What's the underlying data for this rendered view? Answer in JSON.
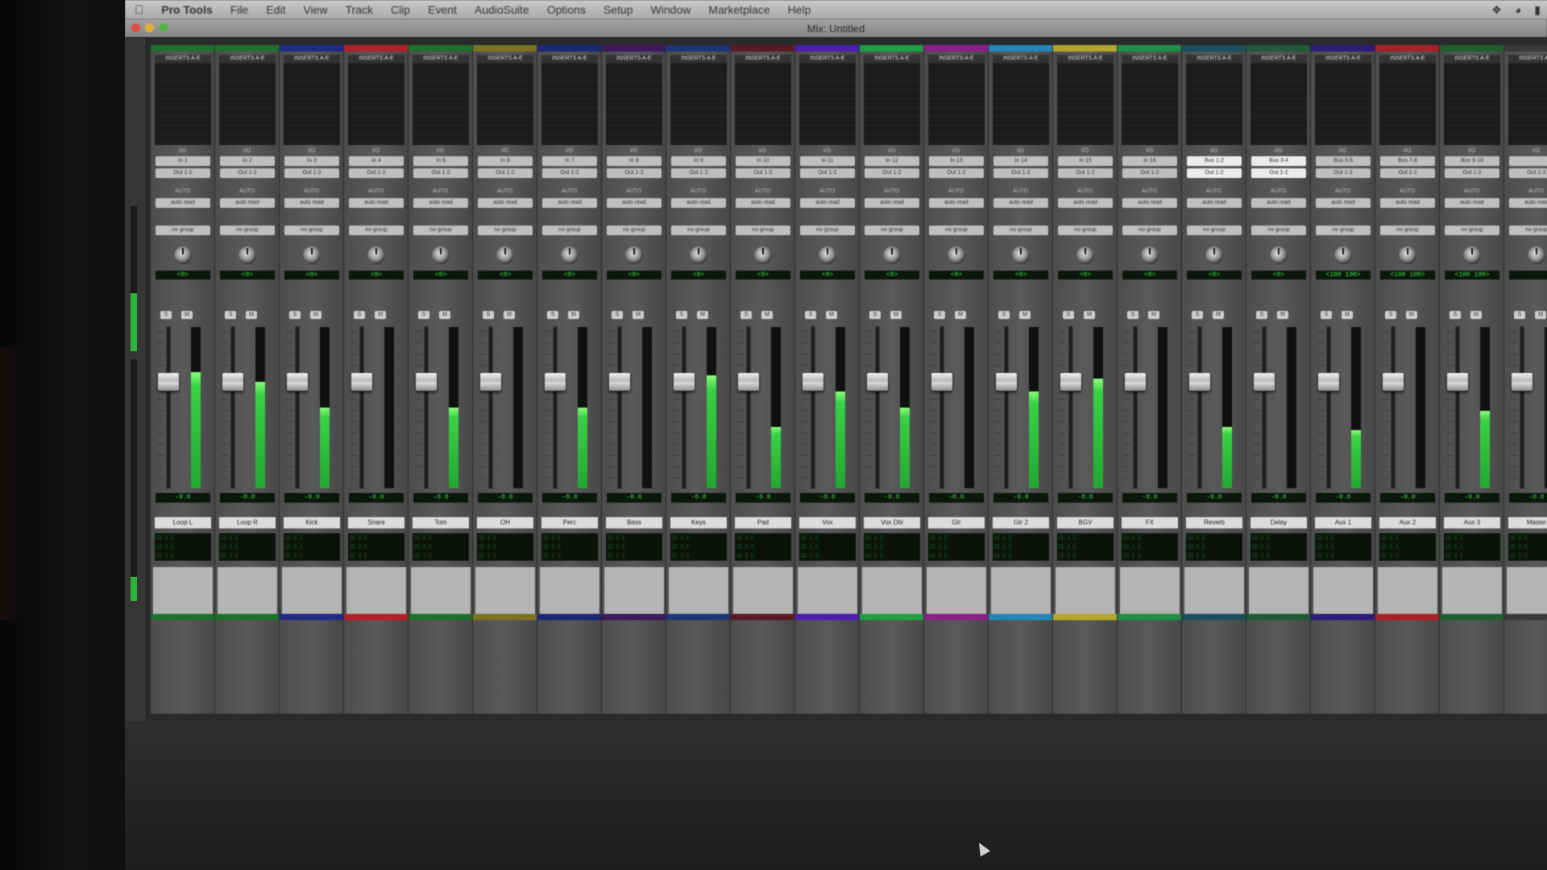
{
  "menubar": {
    "apple_icon": "apple-icon",
    "app_name": "Pro Tools",
    "items": [
      "File",
      "Edit",
      "View",
      "Track",
      "Clip",
      "Event",
      "AudioSuite",
      "Options",
      "Setup",
      "Window",
      "Marketplace",
      "Help"
    ],
    "status_icons": [
      "bluetooth-icon",
      "wifi-icon",
      "battery-icon"
    ]
  },
  "window": {
    "title": "Mix: Untitled"
  },
  "labels": {
    "inserts_header": "INSERTS A-E",
    "io": "I/O",
    "auto": "AUTO",
    "auto_value": "auto read",
    "group_value": "no group",
    "solo": "S",
    "mute": "M"
  },
  "strips": [
    {
      "name": "Loop L",
      "color": "#1f6f2e",
      "input": "In 1",
      "output": "Out 1-2",
      "pan": "<0>",
      "volume": "-0.0",
      "meter": 0.72,
      "fader": 0.68
    },
    {
      "name": "Loop R",
      "color": "#1f6f2e",
      "input": "In 2",
      "output": "Out 1-2",
      "pan": "<0>",
      "volume": "-0.0",
      "meter": 0.66,
      "fader": 0.68
    },
    {
      "name": "Kick",
      "color": "#232a86",
      "input": "In 3",
      "output": "Out 1-2",
      "pan": "<0>",
      "volume": "-0.0",
      "meter": 0.5,
      "fader": 0.68
    },
    {
      "name": "Snare",
      "color": "#b3202a",
      "input": "In 4",
      "output": "Out 1-2",
      "pan": "<0>",
      "volume": "-0.0",
      "meter": 0.0,
      "fader": 0.68
    },
    {
      "name": "Tom",
      "color": "#1f6f2e",
      "input": "In 5",
      "output": "Out 1-2",
      "pan": "<0>",
      "volume": "-0.0",
      "meter": 0.5,
      "fader": 0.68
    },
    {
      "name": "OH",
      "color": "#7a7322",
      "input": "In 6",
      "output": "Out 1-2",
      "pan": "<0>",
      "volume": "-0.0",
      "meter": 0.0,
      "fader": 0.68
    },
    {
      "name": "Perc",
      "color": "#1d2773",
      "input": "In 7",
      "output": "Out 1-2",
      "pan": "<0>",
      "volume": "-0.0",
      "meter": 0.5,
      "fader": 0.68
    },
    {
      "name": "Bass",
      "color": "#3d1a5c",
      "input": "In 8",
      "output": "Out 1-2",
      "pan": "<0>",
      "volume": "-0.0",
      "meter": 0.0,
      "fader": 0.68
    },
    {
      "name": "Keys",
      "color": "#1d3575",
      "input": "In 9",
      "output": "Out 1-2",
      "pan": "<0>",
      "volume": "-0.0",
      "meter": 0.7,
      "fader": 0.68
    },
    {
      "name": "Pad",
      "color": "#5a1b24",
      "input": "In 10",
      "output": "Out 1-2",
      "pan": "<0>",
      "volume": "-0.0",
      "meter": 0.38,
      "fader": 0.68
    },
    {
      "name": "Vox",
      "color": "#4b20b0",
      "input": "In 11",
      "output": "Out 1-2",
      "pan": "<0>",
      "volume": "-0.0",
      "meter": 0.6,
      "fader": 0.68
    },
    {
      "name": "Vox Dbl",
      "color": "#1fa044",
      "input": "In 12",
      "output": "Out 1-2",
      "pan": "<0>",
      "volume": "-0.0",
      "meter": 0.5,
      "fader": 0.68
    },
    {
      "name": "Gtr",
      "color": "#8a1f88",
      "input": "In 13",
      "output": "Out 1-2",
      "pan": "<0>",
      "volume": "-0.0",
      "meter": 0.0,
      "fader": 0.68
    },
    {
      "name": "Gtr 2",
      "color": "#2287b8",
      "input": "In 14",
      "output": "Out 1-2",
      "pan": "<0>",
      "volume": "-0.0",
      "meter": 0.6,
      "fader": 0.68
    },
    {
      "name": "BGV",
      "color": "#b3a72a",
      "input": "In 15",
      "output": "Out 1-2",
      "pan": "<0>",
      "volume": "-0.0",
      "meter": 0.68,
      "fader": 0.68
    },
    {
      "name": "FX",
      "color": "#1f8f4a",
      "input": "In 16",
      "output": "Out 1-2",
      "pan": "<0>",
      "volume": "-0.0",
      "meter": 0.0,
      "fader": 0.68
    },
    {
      "name": "Reverb",
      "color": "#1b4f5e",
      "input": "Bus 1-2",
      "output": "Out 1-2",
      "pan": "<0>",
      "volume": "-0.0",
      "meter": 0.38,
      "fader": 0.68
    },
    {
      "name": "Delay",
      "color": "#205a36",
      "input": "Bus 3-4",
      "output": "Out 1-2",
      "pan": "<0>",
      "volume": "-0.0",
      "meter": 0.0,
      "fader": 0.68
    },
    {
      "name": "Aux 1",
      "color": "#2a1f78",
      "input": "Bus 5-6",
      "output": "Out 1-2",
      "pan": "<100  100>",
      "volume": "-0.0",
      "meter": 0.36,
      "fader": 0.68
    },
    {
      "name": "Aux 2",
      "color": "#a8202a",
      "input": "Bus 7-8",
      "output": "Out 1-2",
      "pan": "<100  100>",
      "volume": "-0.0",
      "meter": 0.0,
      "fader": 0.68
    },
    {
      "name": "Aux 3",
      "color": "#1f5e33",
      "input": "Bus 9-10",
      "output": "Out 1-2",
      "pan": "<100  100>",
      "volume": "-0.0",
      "meter": 0.48,
      "fader": 0.68
    },
    {
      "name": "Master",
      "color": "#3a3a3a",
      "input": "",
      "output": "Out 1-2",
      "pan": "",
      "volume": "-0.0",
      "meter": 0.0,
      "fader": 0.68
    }
  ]
}
